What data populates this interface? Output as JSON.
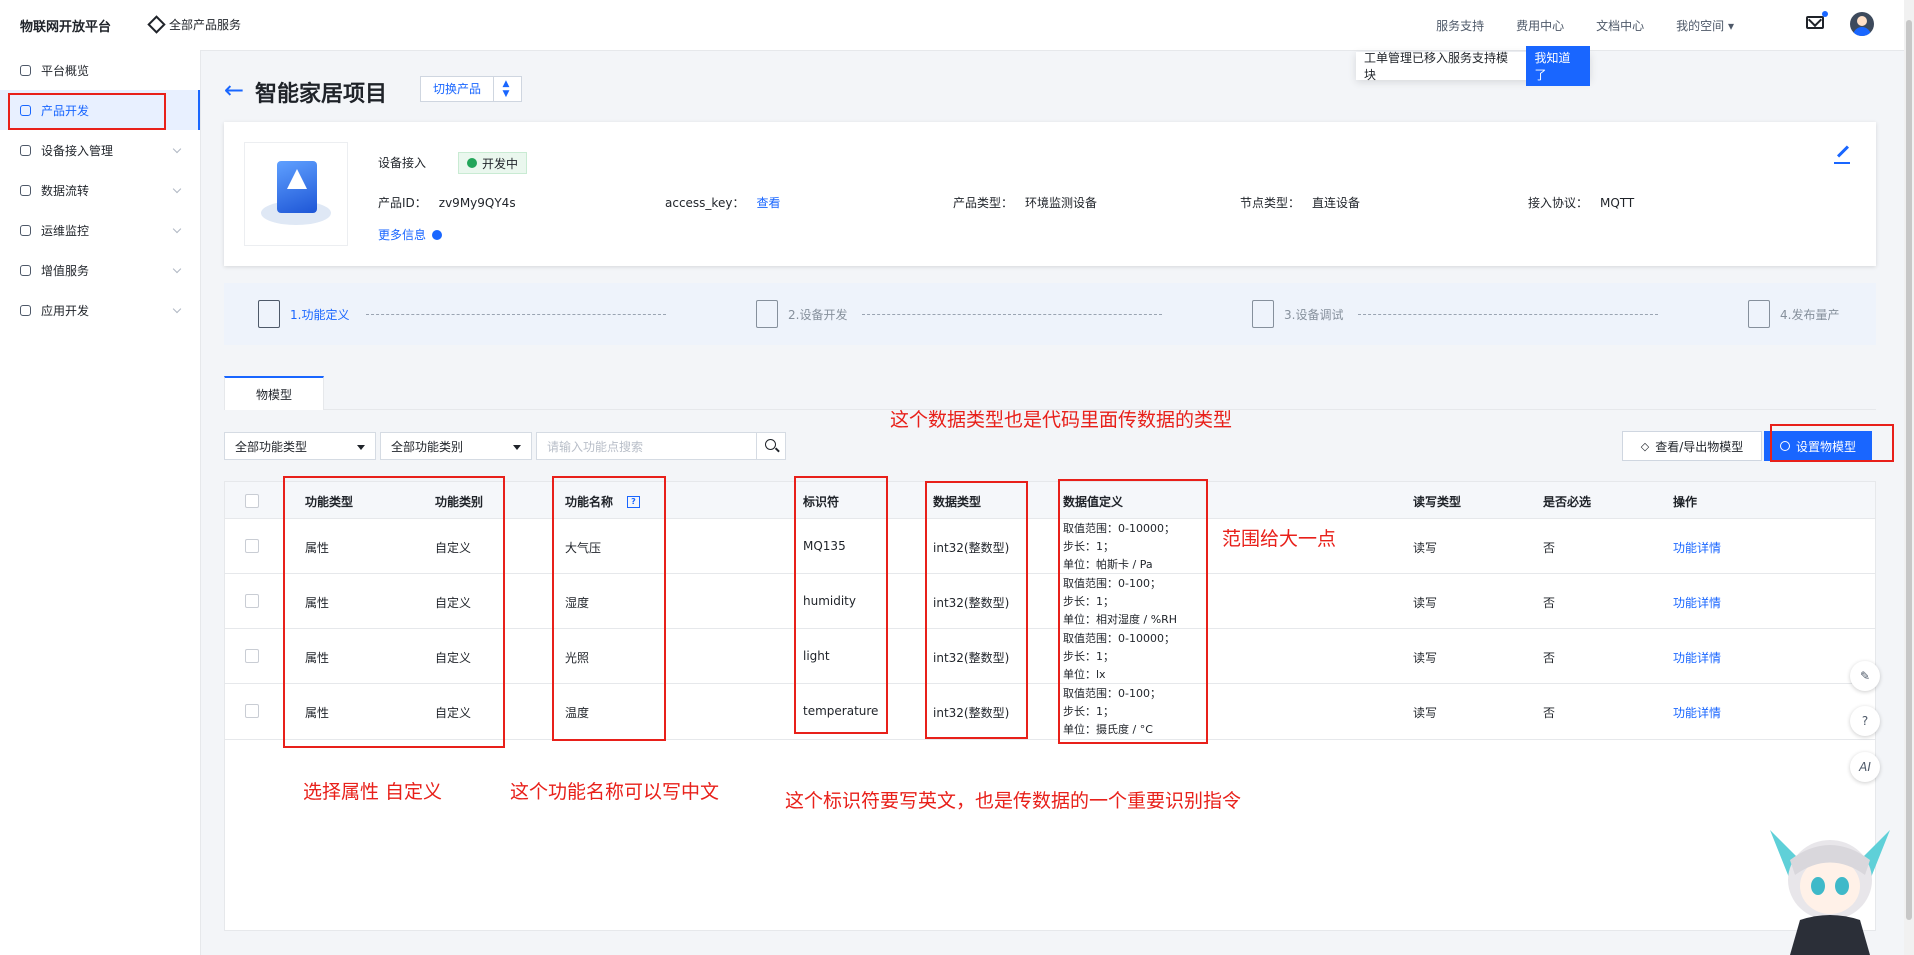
{
  "topbar": {
    "brand": "物联网开放平台",
    "all_products": "全部产品服务",
    "nav": [
      "服务支持",
      "费用中心",
      "文档中心",
      "我的空间 ▾"
    ],
    "tooltip_text": "工单管理已移入服务支持模块",
    "tooltip_button": "我知道了"
  },
  "sidebar": {
    "items": [
      {
        "label": "平台概览",
        "icon": "overview-icon"
      },
      {
        "label": "产品开发",
        "icon": "cube-icon",
        "active": true
      },
      {
        "label": "设备接入管理",
        "icon": "device-icon"
      },
      {
        "label": "数据流转",
        "icon": "dataflow-icon"
      },
      {
        "label": "运维监控",
        "icon": "monitor-icon"
      },
      {
        "label": "增值服务",
        "icon": "send-icon"
      },
      {
        "label": "应用开发",
        "icon": "app-icon"
      }
    ]
  },
  "header": {
    "title": "智能家居项目",
    "switch_label": "切换产品"
  },
  "product": {
    "device_access": "设备接入",
    "status": "开发中",
    "fields": [
      {
        "key": "产品ID：",
        "value": "zv9My9QY4s"
      },
      {
        "key": "access_key：",
        "value": "查看",
        "link": true
      },
      {
        "key": "产品类型：",
        "value": "环境监测设备"
      },
      {
        "key": "节点类型：",
        "value": "直连设备"
      },
      {
        "key": "接入协议：",
        "value": "MQTT"
      }
    ],
    "more": "更多信息"
  },
  "steps": [
    "1.功能定义",
    "2.设备开发",
    "3.设备调试",
    "4.发布量产"
  ],
  "tab": "物模型",
  "filters": {
    "type": "全部功能类型",
    "category": "全部功能类别",
    "search_placeholder": "请输入功能点搜索",
    "export_btn": "查看/导出物模型",
    "set_btn": "设置物模型"
  },
  "table": {
    "headers": [
      "功能类型",
      "功能类别",
      "功能名称",
      "标识符",
      "数据类型",
      "数据值定义",
      "读写类型",
      "是否必选",
      "操作"
    ],
    "rows": [
      {
        "type": "属性",
        "category": "自定义",
        "name": "大气压",
        "identifier": "MQ135",
        "dtype": "int32(整数型)",
        "def": [
          "取值范围：0-10000；",
          "步长：1；",
          "单位：帕斯卡 / Pa"
        ],
        "rw": "读写",
        "required": "否",
        "action": "功能详情"
      },
      {
        "type": "属性",
        "category": "自定义",
        "name": "湿度",
        "identifier": "humidity",
        "dtype": "int32(整数型)",
        "def": [
          "取值范围：0-100；",
          "步长：1；",
          "单位：相对湿度 / %RH"
        ],
        "rw": "读写",
        "required": "否",
        "action": "功能详情"
      },
      {
        "type": "属性",
        "category": "自定义",
        "name": "光照",
        "identifier": "light",
        "dtype": "int32(整数型)",
        "def": [
          "取值范围：0-10000；",
          "步长：1；",
          "单位：lx"
        ],
        "rw": "读写",
        "required": "否",
        "action": "功能详情"
      },
      {
        "type": "属性",
        "category": "自定义",
        "name": "温度",
        "identifier": "temperature",
        "dtype": "int32(整数型)",
        "def": [
          "取值范围：0-100；",
          "步长：1；",
          "单位：摄氏度 / °C"
        ],
        "rw": "读写",
        "required": "否",
        "action": "功能详情"
      }
    ]
  },
  "annotations": {
    "datatype_note": "这个数据类型也是代码里面传数据的类型",
    "range_note": "范围给大一点",
    "attr_note": "选择属性  自定义",
    "name_note": "这个功能名称可以写中文",
    "identifier_note": "这个标识符要写英文，也是传数据的一个重要识别指令"
  },
  "float_buttons": [
    "✎",
    "?",
    "AI"
  ],
  "colors": {
    "accent": "#1966ff",
    "annotation": "#e8201a"
  }
}
